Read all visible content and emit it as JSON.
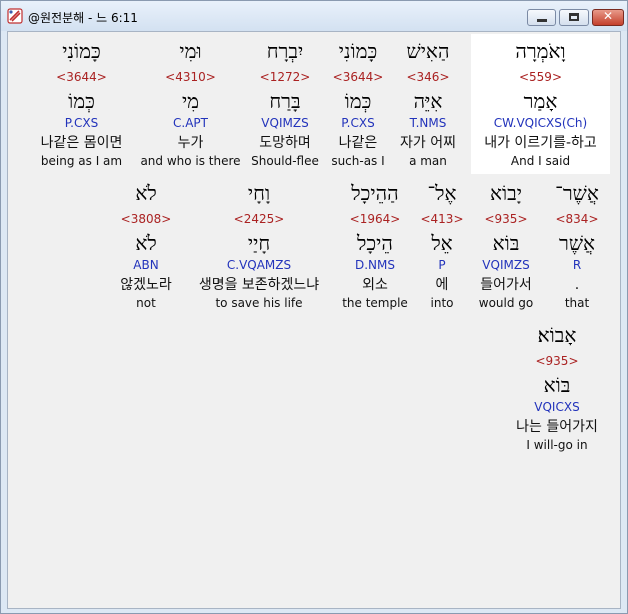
{
  "window": {
    "title": "@원전분해 - 느 6:11",
    "min_label": "",
    "max_label": "",
    "close_label": "✕"
  },
  "words": [
    {
      "hebrew": "וָאֹמְרָה",
      "strong": "<559>",
      "lemma": "אָמַר",
      "morph": "CW.VQICXS(Ch)",
      "korean": "내가 이르기를-하고",
      "english": "And I said",
      "selected": true
    },
    {
      "hebrew": "הַאִישׁ",
      "strong": "<346>",
      "lemma": "אִיֵּה",
      "morph": "T.NMS",
      "korean": "자가 어찌",
      "english": "a man"
    },
    {
      "hebrew": "כָּמוֹנִי",
      "strong": "<3644>",
      "lemma": "כְּמוֹ",
      "morph": "P.CXS",
      "korean": "나같은",
      "english": "such-as I"
    },
    {
      "hebrew": "יִבְרָח",
      "strong": "<1272>",
      "lemma": "בָּרַח",
      "morph": "VQIMZS",
      "korean": "도망하며",
      "english": "Should-flee"
    },
    {
      "hebrew": "וּמִי",
      "strong": "<4310>",
      "lemma": "מִי",
      "morph": "C.APT",
      "korean": "누가",
      "english": "and who is there"
    },
    {
      "hebrew": "כָּמוֹנִי",
      "strong": "<3644>",
      "lemma": "כְּמוֹ",
      "morph": "P.CXS",
      "korean": "나같은 몸이면",
      "english": "being as I am"
    },
    {
      "hebrew": "אֲשֶׁר־",
      "strong": "<834>",
      "lemma": "אֲשֶׁר",
      "morph": "R",
      "korean": ".",
      "english": "that"
    },
    {
      "hebrew": "יָבוֹא",
      "strong": "<935>",
      "lemma": "בּוֹא",
      "morph": "VQIMZS",
      "korean": "들어가서",
      "english": "would go"
    },
    {
      "hebrew": "אֶל־",
      "strong": "<413>",
      "lemma": "אֵל",
      "morph": "P",
      "korean": "에",
      "english": "into"
    },
    {
      "hebrew": "הַהֵיכָל",
      "strong": "<1964>",
      "lemma": "הֵיכָל",
      "morph": "D.NMS",
      "korean": "외소",
      "english": "the temple"
    },
    {
      "hebrew": "וָחָי",
      "strong": "<2425>",
      "lemma": "חָיַי",
      "morph": "C.VQAMZS",
      "korean": "생명을 보존하겠느냐",
      "english": "to save his life"
    },
    {
      "hebrew": "לֹא",
      "strong": "<3808>",
      "lemma": "לֹא",
      "morph": "ABN",
      "korean": "않겠노라",
      "english": "not"
    },
    {
      "hebrew": "אָבוֹא׃",
      "strong": "<935>",
      "lemma": "בּוֹא",
      "morph": "VQICXS",
      "korean": "나는 들어가지",
      "english": "I will-go in"
    }
  ]
}
